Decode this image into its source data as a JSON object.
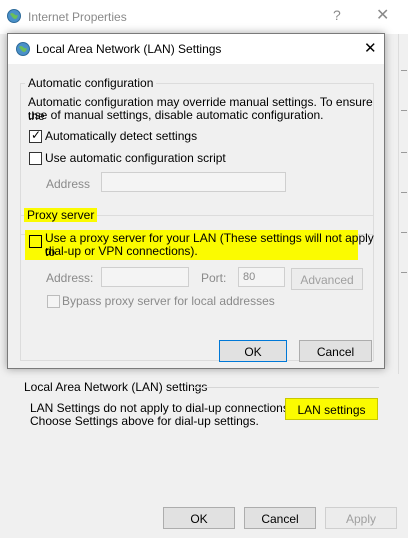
{
  "parent": {
    "title": "Internet Properties",
    "help_glyph": "?",
    "close_glyph": "✕",
    "lan_section_label": "Local Area Network (LAN) settings",
    "lan_desc_line1": "LAN Settings do not apply to dial-up connections.",
    "lan_desc_line2": "Choose Settings above for dial-up settings.",
    "lan_settings_button": "LAN settings",
    "ok_button": "OK",
    "cancel_button": "Cancel",
    "apply_button": "Apply"
  },
  "dialog": {
    "title": "Local Area Network (LAN) Settings",
    "close_glyph": "✕",
    "auto_config": {
      "legend": "Automatic configuration",
      "desc_line1": "Automatic configuration may override manual settings.  To ensure the",
      "desc_line2": "use of manual settings, disable automatic configuration.",
      "auto_detect_label": "Automatically detect settings",
      "auto_detect_checked": true,
      "use_script_label": "Use automatic configuration script",
      "use_script_checked": false,
      "address_label": "Address",
      "address_value": ""
    },
    "proxy": {
      "legend": "Proxy server",
      "use_proxy_line1": "Use a proxy server for your LAN (These settings will not apply to",
      "use_proxy_line2": "dial-up or VPN connections).",
      "use_proxy_checked": false,
      "address_label": "Address:",
      "address_value": "",
      "port_label": "Port:",
      "port_value": "80",
      "advanced_button": "Advanced",
      "bypass_label": "Bypass proxy server for local addresses",
      "bypass_checked": false
    },
    "ok_button": "OK",
    "cancel_button": "Cancel"
  },
  "colors": {
    "highlight": "#fbfb00",
    "focus_border": "#0078d7",
    "window_bg": "#f0f0f0"
  }
}
